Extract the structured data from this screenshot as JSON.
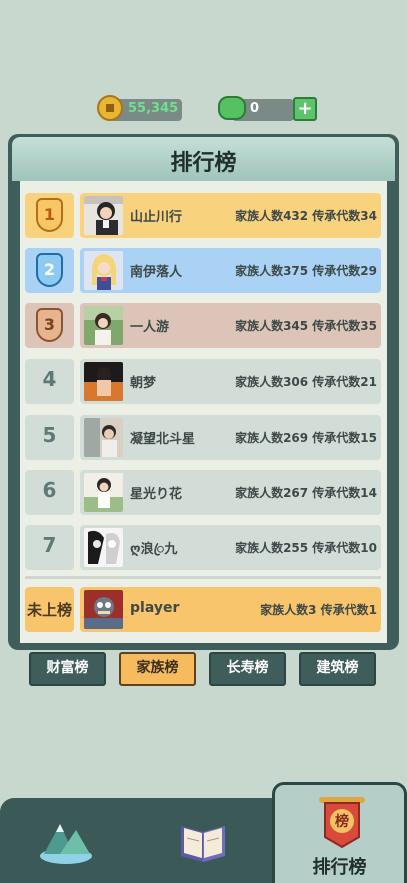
{
  "topbar": {
    "coin_value": "55,345",
    "gem_value": "0",
    "plus_label": "+"
  },
  "panel": {
    "title": "排行榜"
  },
  "rankings": [
    {
      "rank": "1",
      "name": "山止川行",
      "stats": "家族人数432 传承代数34",
      "color": "#f9d27e",
      "badge_color": "#f6b44a"
    },
    {
      "rank": "2",
      "name": "南伊落人",
      "stats": "家族人数375 传承代数29",
      "color": "#a9d2f4",
      "badge_color": "#66b2ea"
    },
    {
      "rank": "3",
      "name": "一人游",
      "stats": "家族人数345 传承代数35",
      "color": "#dcc4b8",
      "badge_color": "#c79a78"
    },
    {
      "rank": "4",
      "name": "朝梦",
      "stats": "家族人数306 传承代数21",
      "color": "#d2ddd8"
    },
    {
      "rank": "5",
      "name": "凝望北斗星",
      "stats": "家族人数269 传承代数15",
      "color": "#d2ddd8"
    },
    {
      "rank": "6",
      "name": "星光り花",
      "stats": "家族人数267 传承代数14",
      "color": "#d2ddd8"
    },
    {
      "rank": "7",
      "name": "ღ浪ꦿ九",
      "stats": "家族人数255 传承代数10",
      "color": "#d2ddd8"
    }
  ],
  "player_row": {
    "rank_label": "未上榜",
    "name": "player",
    "stats": "家族人数3 传承代数1",
    "color": "#f8c46c"
  },
  "tabs": [
    {
      "label": "财富榜",
      "active": false
    },
    {
      "label": "家族榜",
      "active": true
    },
    {
      "label": "长寿榜",
      "active": false
    },
    {
      "label": "建筑榜",
      "active": false
    }
  ],
  "bottom_nav": {
    "active_label": "排行榜",
    "active_badge": "榜"
  }
}
